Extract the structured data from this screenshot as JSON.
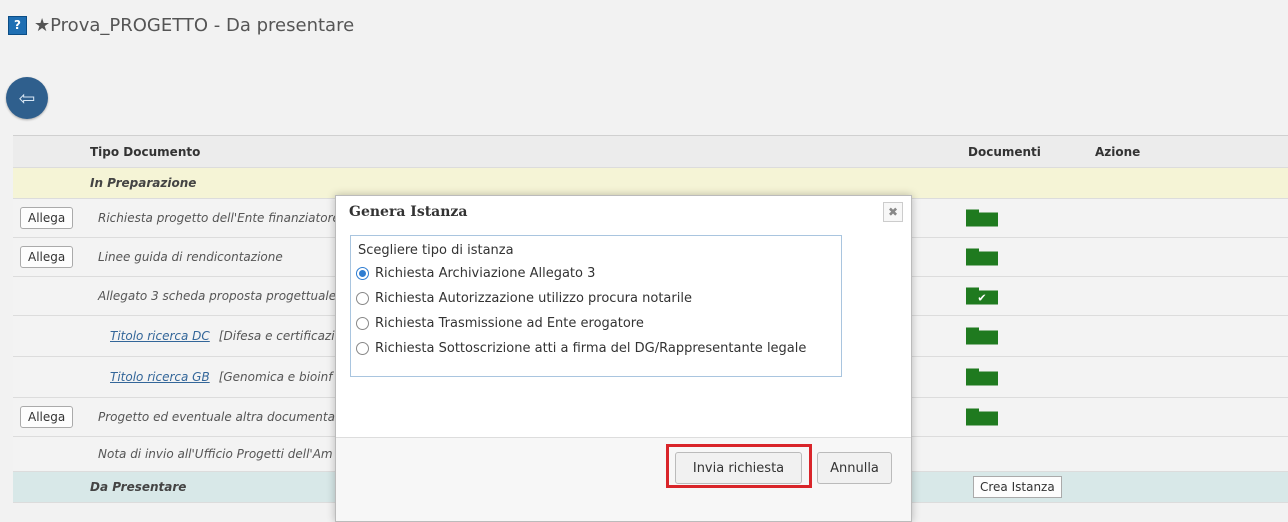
{
  "page": {
    "title": "★Prova_PROGETTO - Da presentare",
    "help_icon": "?"
  },
  "back_button": {
    "icon": "back-arrow-icon"
  },
  "table": {
    "headers": {
      "tipo": "Tipo Documento",
      "documenti": "Documenti",
      "azione": "Azione"
    },
    "sections": {
      "in_prep": "In Preparazione",
      "da_presentare": "Da Presentare"
    },
    "rows": [
      {
        "button": "Allega",
        "text": "Richiesta progetto dell'Ente finanziatore",
        "folder": "folder",
        "checked": false
      },
      {
        "button": "Allega",
        "text": "Linee guida di rendicontazione",
        "folder": "folder",
        "checked": false
      },
      {
        "button": "",
        "text": "Allegato 3 scheda proposta progettuale",
        "folder": "folder",
        "checked": true
      },
      {
        "link": "Titolo ricerca DC",
        "text": "[Difesa e certificazi",
        "folder": "folder",
        "checked": false
      },
      {
        "link": "Titolo ricerca GB",
        "text": "[Genomica e bioinf",
        "folder": "folder",
        "checked": false
      },
      {
        "button": "Allega",
        "text": "Progetto ed eventuale altra documentaz",
        "folder": "folder",
        "checked": false
      },
      {
        "text": "Nota di invio all'Ufficio Progetti dell'Am"
      }
    ],
    "crea_istanza": "Crea Istanza",
    "checkmark": "✔"
  },
  "dialog": {
    "title": "Genera Istanza",
    "close_label": "✖",
    "caption": "Scegliere tipo di istanza",
    "options": [
      {
        "label": "Richiesta Archiviazione Allegato 3",
        "selected": true
      },
      {
        "label": "Richiesta Autorizzazione utilizzo procura notarile",
        "selected": false
      },
      {
        "label": "Richiesta Trasmissione ad Ente erogatore",
        "selected": false
      },
      {
        "label": "Richiesta Sottoscrizione atti a firma del DG/Rappresentante legale",
        "selected": false
      }
    ],
    "send_label": "Invia richiesta",
    "cancel_label": "Annulla"
  },
  "colors": {
    "folder": "#1f7a1f",
    "highlight": "#d9252a",
    "back_button": "#2f5f8d"
  }
}
